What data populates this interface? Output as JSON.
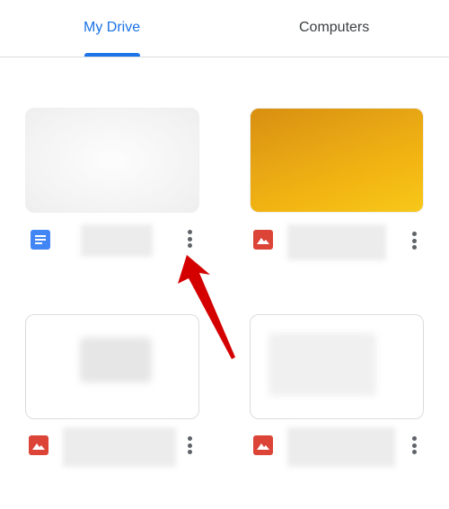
{
  "tabs": [
    {
      "label": "My Drive",
      "active": true
    },
    {
      "label": "Computers",
      "active": false
    }
  ],
  "colors": {
    "accent": "#1a73e8",
    "tab_inactive": "#3c4043",
    "docs_icon": "#4285f4",
    "image_icon": "#db4437",
    "more_icon": "#5f6368",
    "annotation_arrow": "#d40000"
  },
  "files": [
    {
      "type": "document",
      "icon": "google-docs-icon",
      "name_redacted": true,
      "thumbnail": "blank-document"
    },
    {
      "type": "image",
      "icon": "image-file-icon",
      "name_redacted": true,
      "thumbnail": "gold-gradient"
    },
    {
      "type": "image",
      "icon": "image-file-icon",
      "name_redacted": true,
      "thumbnail": "phone-screenshot"
    },
    {
      "type": "image",
      "icon": "image-file-icon",
      "name_redacted": true,
      "thumbnail": "phone-screenshot"
    }
  ],
  "annotation": {
    "type": "arrow",
    "points_to": "first-file-more-options"
  }
}
